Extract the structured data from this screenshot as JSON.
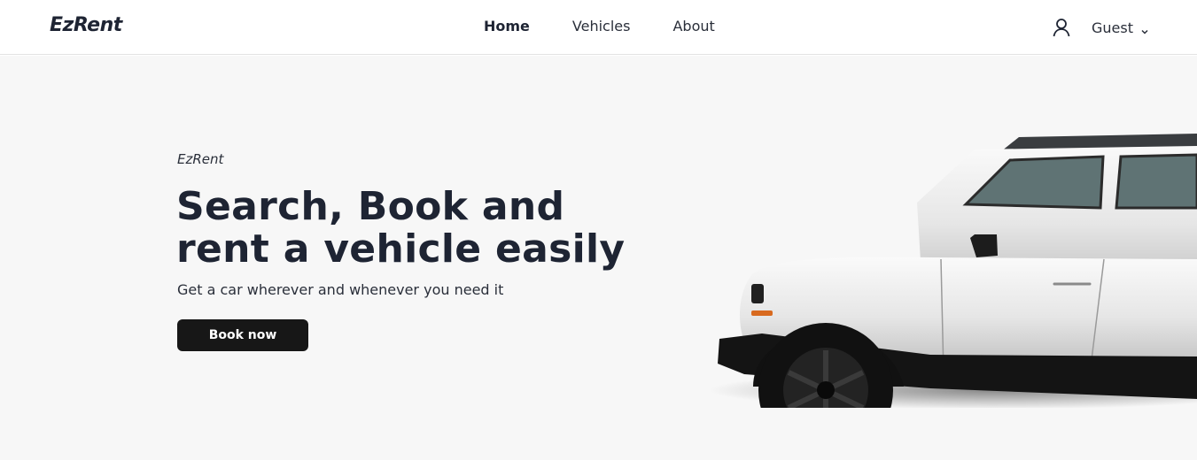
{
  "nav": {
    "logo": "EzRent",
    "links": [
      "Home",
      "Vehicles",
      "About"
    ],
    "active_link": "Home",
    "user_label": "Guest",
    "user_icon": "user-icon",
    "dropdown_icon": "chevron-down-icon"
  },
  "hero": {
    "eyebrow": "EzRent",
    "headline_line1": "Search, Book and",
    "headline_line2": "rent a vehicle easily",
    "subtext": "Get a car wherever and whenever you need it",
    "cta_label": "Book now",
    "image": "white-suv-side-view"
  },
  "colors": {
    "text_primary": "#1e2433",
    "hero_background": "#f7f7f7",
    "button_background": "#171717",
    "button_text": "#ffffff"
  }
}
